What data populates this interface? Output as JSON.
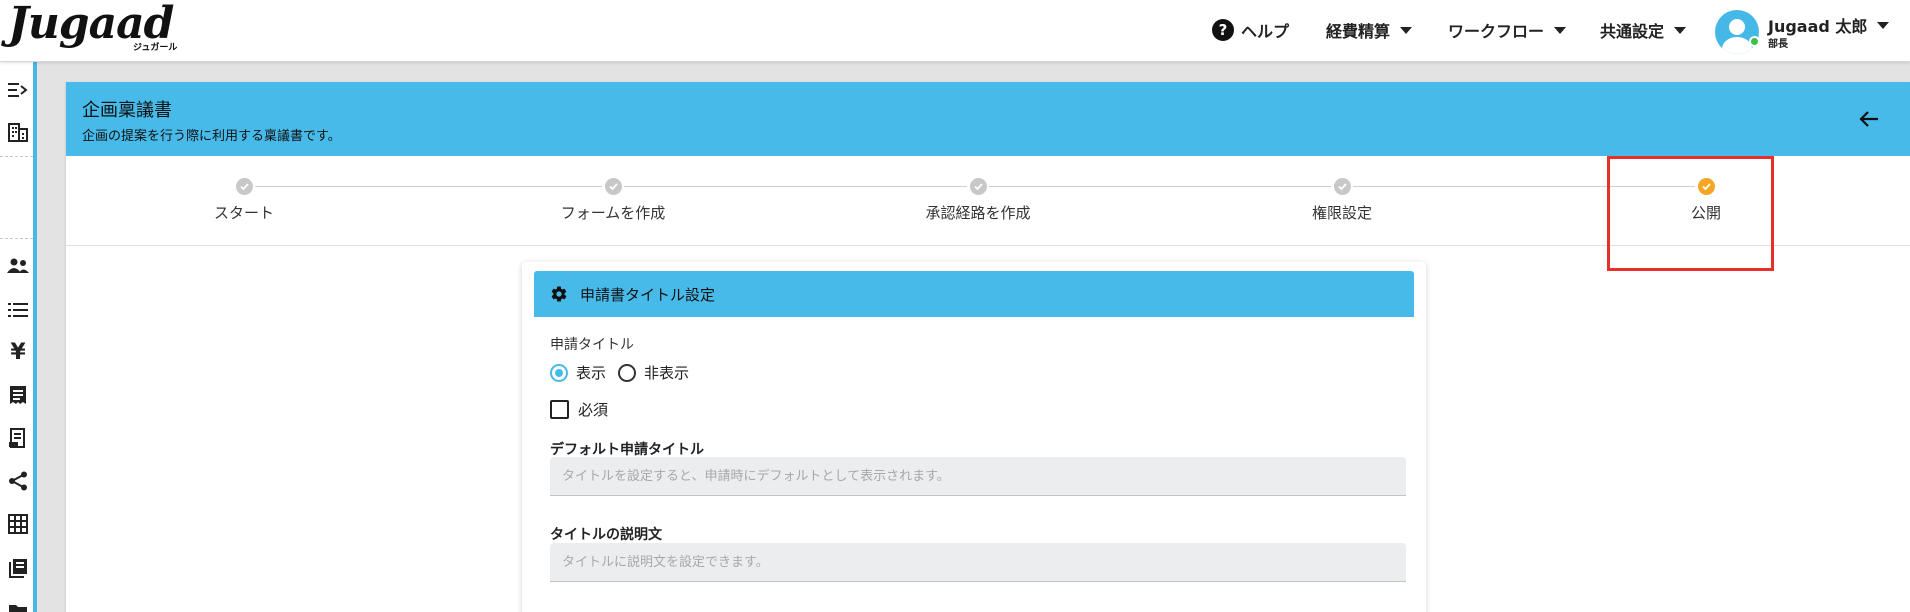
{
  "header": {
    "logo_text": "Jugaad",
    "logo_sub": "ジュガール",
    "nav": [
      {
        "label": "ヘルプ",
        "icon": "help-icon"
      },
      {
        "label": "経費精算"
      },
      {
        "label": "ワークフロー"
      },
      {
        "label": "共通設定"
      }
    ],
    "user": {
      "name": "Jugaad 太郎",
      "role": "部長"
    }
  },
  "sidebar": {
    "icons": [
      "collapse-icon",
      "building-icon",
      "users-icon",
      "list-icon",
      "yen-icon",
      "receipt-icon",
      "document-icon",
      "share-icon",
      "grid-icon",
      "book-icon"
    ]
  },
  "page": {
    "title": "企画稟議書",
    "subtitle": "企画の提案を行う際に利用する稟議書です。"
  },
  "stepper": {
    "steps": [
      {
        "label": "スタート",
        "active": false
      },
      {
        "label": "フォームを作成",
        "active": false
      },
      {
        "label": "承認経路を作成",
        "active": false
      },
      {
        "label": "権限設定",
        "active": false
      },
      {
        "label": "公開",
        "active": true
      }
    ],
    "active_color": "#f5a623"
  },
  "panel": {
    "title": "申請書タイトル設定",
    "title_label": "申請タイトル",
    "radio_show": "表示",
    "radio_hide": "非表示",
    "selected": "表示",
    "required_label": "必須",
    "default_title_label": "デフォルト申請タイトル",
    "default_title_placeholder": "タイトルを設定すると、申請時にデフォルトとして表示されます。",
    "description_label": "タイトルの説明文",
    "description_placeholder": "タイトルに説明文を設定できます。"
  },
  "colors": {
    "accent": "#47baea",
    "highlight": "#e8302a"
  }
}
